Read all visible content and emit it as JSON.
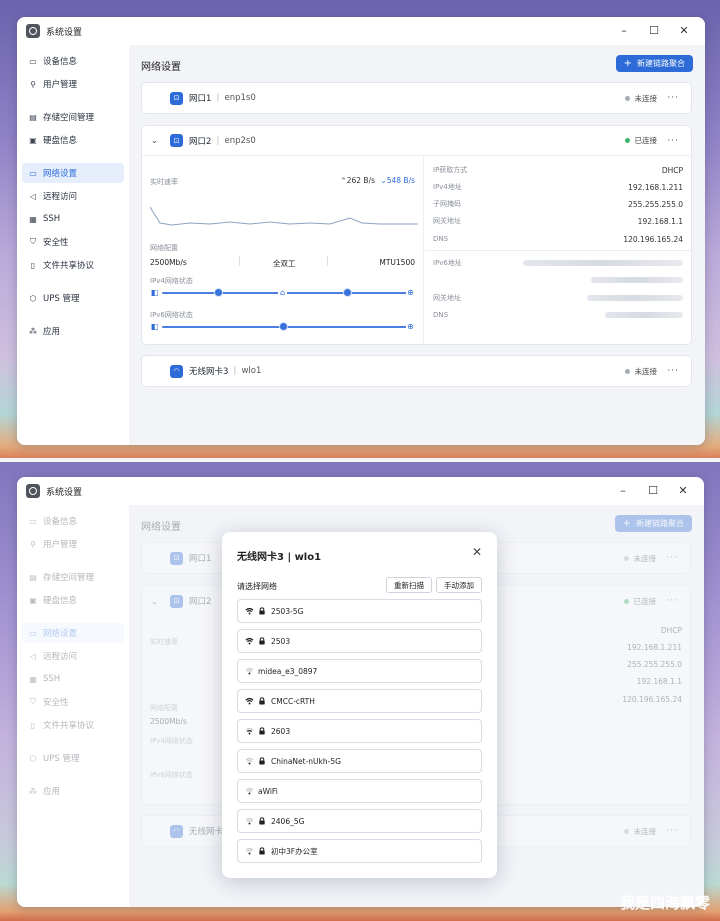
{
  "app": {
    "title": "系统设置"
  },
  "window_controls": {
    "minimize": "–",
    "maximize": "☐",
    "close": "✕"
  },
  "sidebar": {
    "items": [
      {
        "label": "设备信息",
        "icon": "monitor-icon"
      },
      {
        "label": "用户管理",
        "icon": "user-icon"
      },
      {
        "label": "存储空间管理",
        "icon": "storage-icon"
      },
      {
        "label": "硬盘信息",
        "icon": "disk-icon"
      },
      {
        "label": "网络设置",
        "icon": "network-icon",
        "active": true
      },
      {
        "label": "远程访问",
        "icon": "send-icon"
      },
      {
        "label": "SSH",
        "icon": "terminal-icon"
      },
      {
        "label": "安全性",
        "icon": "shield-icon"
      },
      {
        "label": "文件共享协议",
        "icon": "file-icon"
      },
      {
        "label": "UPS 管理",
        "icon": "power-icon"
      },
      {
        "label": "应用",
        "icon": "apps-icon"
      }
    ]
  },
  "main": {
    "title": "网络设置",
    "new_button": "新建链路聚合",
    "cards": [
      {
        "name": "网口1",
        "iface": "enp1s0",
        "status": "未连接",
        "status_color": "#a6abb4"
      },
      {
        "name": "网口2",
        "iface": "enp2s0",
        "status": "已连接",
        "status_color": "#3bb56b",
        "realtime_label": "实时速率",
        "upload": "262 B/s",
        "download": "548 B/s",
        "config_label": "网络配置",
        "speed": "2500Mb/s",
        "duplex": "全双工",
        "mtu": "MTU1500",
        "ipv4_status_label": "IPv4网络状态",
        "ipv6_status_label": "IPv6网络状态",
        "details": [
          {
            "k": "IP获取方式",
            "v": "DHCP"
          },
          {
            "k": "IPv4地址",
            "v": "192.168.1.211"
          },
          {
            "k": "子网掩码",
            "v": "255.255.255.0"
          },
          {
            "k": "网关地址",
            "v": "192.168.1.1"
          },
          {
            "k": "DNS",
            "v": "120.196.165.24"
          }
        ],
        "ipv6_labels": {
          "addr": "IPv6地址",
          "gateway": "网关地址",
          "dns": "DNS"
        }
      },
      {
        "name": "无线网卡3",
        "iface": "wlo1",
        "status": "未连接",
        "status_color": "#a6abb4"
      }
    ]
  },
  "dialog": {
    "title": "无线网卡3 | wlo1",
    "subtitle": "请选择网络",
    "rescan": "重新扫描",
    "manual_add": "手动添加",
    "networks": [
      {
        "ssid": "2503-5G",
        "signal": 3,
        "locked": true
      },
      {
        "ssid": "2503",
        "signal": 3,
        "locked": true
      },
      {
        "ssid": "midea_e3_0897",
        "signal": 1,
        "locked": false
      },
      {
        "ssid": "CMCC-cRTH",
        "signal": 3,
        "locked": true
      },
      {
        "ssid": "2603",
        "signal": 2,
        "locked": true
      },
      {
        "ssid": "ChinaNet-nUkh-5G",
        "signal": 1,
        "locked": true
      },
      {
        "ssid": "aWiFi",
        "signal": 1,
        "locked": false
      },
      {
        "ssid": "2406_5G",
        "signal": 1,
        "locked": true
      },
      {
        "ssid": "初中3F办公室",
        "signal": 1,
        "locked": true
      }
    ]
  },
  "watermark": "我是四海飘零",
  "colors": {
    "accent": "#2d6bd8",
    "connected": "#3bb56b",
    "disconnected": "#a6abb4"
  }
}
